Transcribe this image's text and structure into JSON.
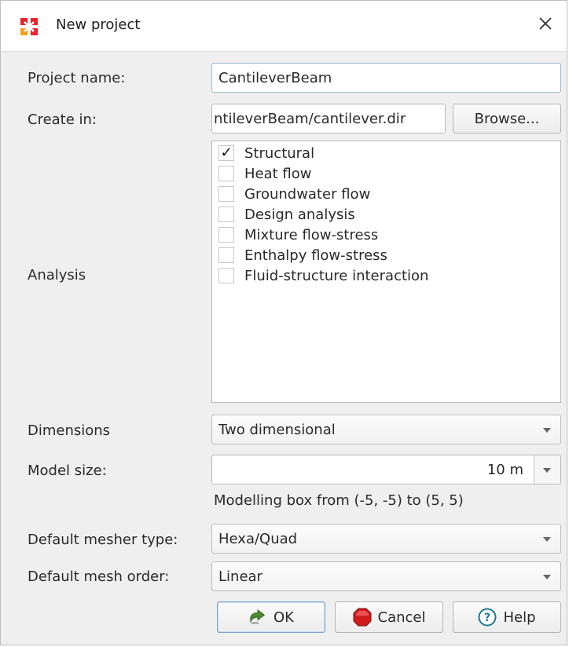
{
  "window": {
    "title": "New project",
    "logo": "diana-logo",
    "close_icon": "close-icon"
  },
  "form": {
    "project_name": {
      "label": "Project name:",
      "value": "CantileverBeam"
    },
    "create_in": {
      "label": "Create in:",
      "value": "ntileverBeam/cantilever.dir",
      "browse_label": "Browse..."
    },
    "analysis": {
      "label": "Analysis",
      "items": [
        {
          "label": "Structural",
          "checked": true
        },
        {
          "label": "Heat flow",
          "checked": false
        },
        {
          "label": "Groundwater flow",
          "checked": false
        },
        {
          "label": "Design analysis",
          "checked": false
        },
        {
          "label": "Mixture flow-stress",
          "checked": false
        },
        {
          "label": "Enthalpy flow-stress",
          "checked": false
        },
        {
          "label": "Fluid-structure interaction",
          "checked": false
        }
      ],
      "check_mark": "✓"
    },
    "dimensions": {
      "label": "Dimensions",
      "value": "Two dimensional"
    },
    "model_size": {
      "label": "Model size:",
      "value": "10 m"
    },
    "modelling_box": "Modelling box from (-5, -5) to (5, 5)",
    "mesher_type": {
      "label": "Default mesher type:",
      "value": "Hexa/Quad"
    },
    "mesh_order": {
      "label": "Default mesh order:",
      "value": "Linear"
    }
  },
  "buttons": {
    "ok": {
      "label": "OK",
      "icon": "check-arrow-icon"
    },
    "cancel": {
      "label": "Cancel",
      "icon": "stop-icon"
    },
    "help": {
      "label": "Help",
      "icon": "help-icon"
    }
  },
  "colors": {
    "dialog_bg": "#efefef",
    "logo_red": "#e8222a",
    "logo_orange": "#f5a21b",
    "ok_icon_green": "#4f8a36",
    "cancel_icon_red": "#d21c1c",
    "help_icon_teal": "#1f7a8c"
  }
}
